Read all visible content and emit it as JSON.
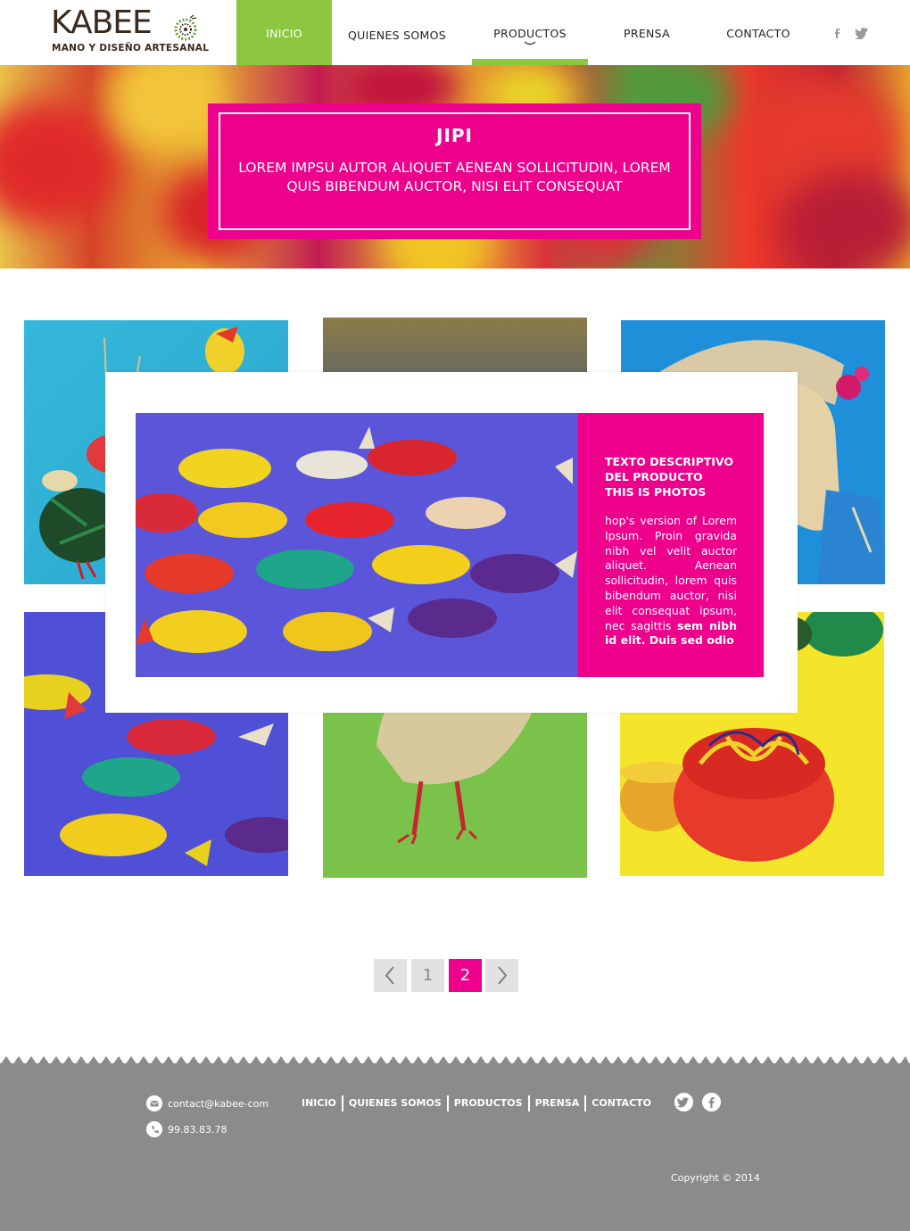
{
  "brand": {
    "name": "KABEE",
    "tagline": "MANO Y DISEÑO ARTESANAL"
  },
  "nav": {
    "items": [
      {
        "label": "INICIO"
      },
      {
        "label": "QUIENES SOMOS"
      },
      {
        "label": "PRODUCTOS"
      },
      {
        "label": "PRENSA"
      },
      {
        "label": "CONTACTO"
      }
    ],
    "social": [
      "facebook-icon",
      "twitter-icon"
    ]
  },
  "hero": {
    "title": "JIPI",
    "text": "LOREM IMPSU AUTOR ALIQUET AENEAN SOLLICITUDIN, LOREM QUIS BIBENDUM AUCTOR, NISI ELIT CONSEQUAT"
  },
  "modal": {
    "title_lines": [
      "TEXTO DESCRIPTIVO",
      "DEL PRODUCTO",
      "THIS IS PHOTOS"
    ],
    "body": "hop's version of Lorem Ipsum. Proin gravida nibh vel velit auctor aliquet. Aenean sollicitudin, lorem quis bibendum auctor, nisi elit consequat ipsum, nec sagittis",
    "body_bold": "sem nibh id elit. Duis sed odio"
  },
  "pagination": {
    "prev": "‹",
    "pages": [
      "1",
      "2"
    ],
    "current": "2",
    "next": "›"
  },
  "footer": {
    "email": "contact@kabee-com",
    "phone": "99.83.83.78",
    "nav": [
      "INICIO",
      "QUIENES SOMOS",
      "PRODUCTOS",
      "PRENSA",
      "CONTACTO"
    ],
    "copyright": "Copyright © 2014"
  },
  "colors": {
    "accent_green": "#8dc63f",
    "accent_pink": "#ec008c",
    "footer_gray": "#8b8b8b"
  }
}
